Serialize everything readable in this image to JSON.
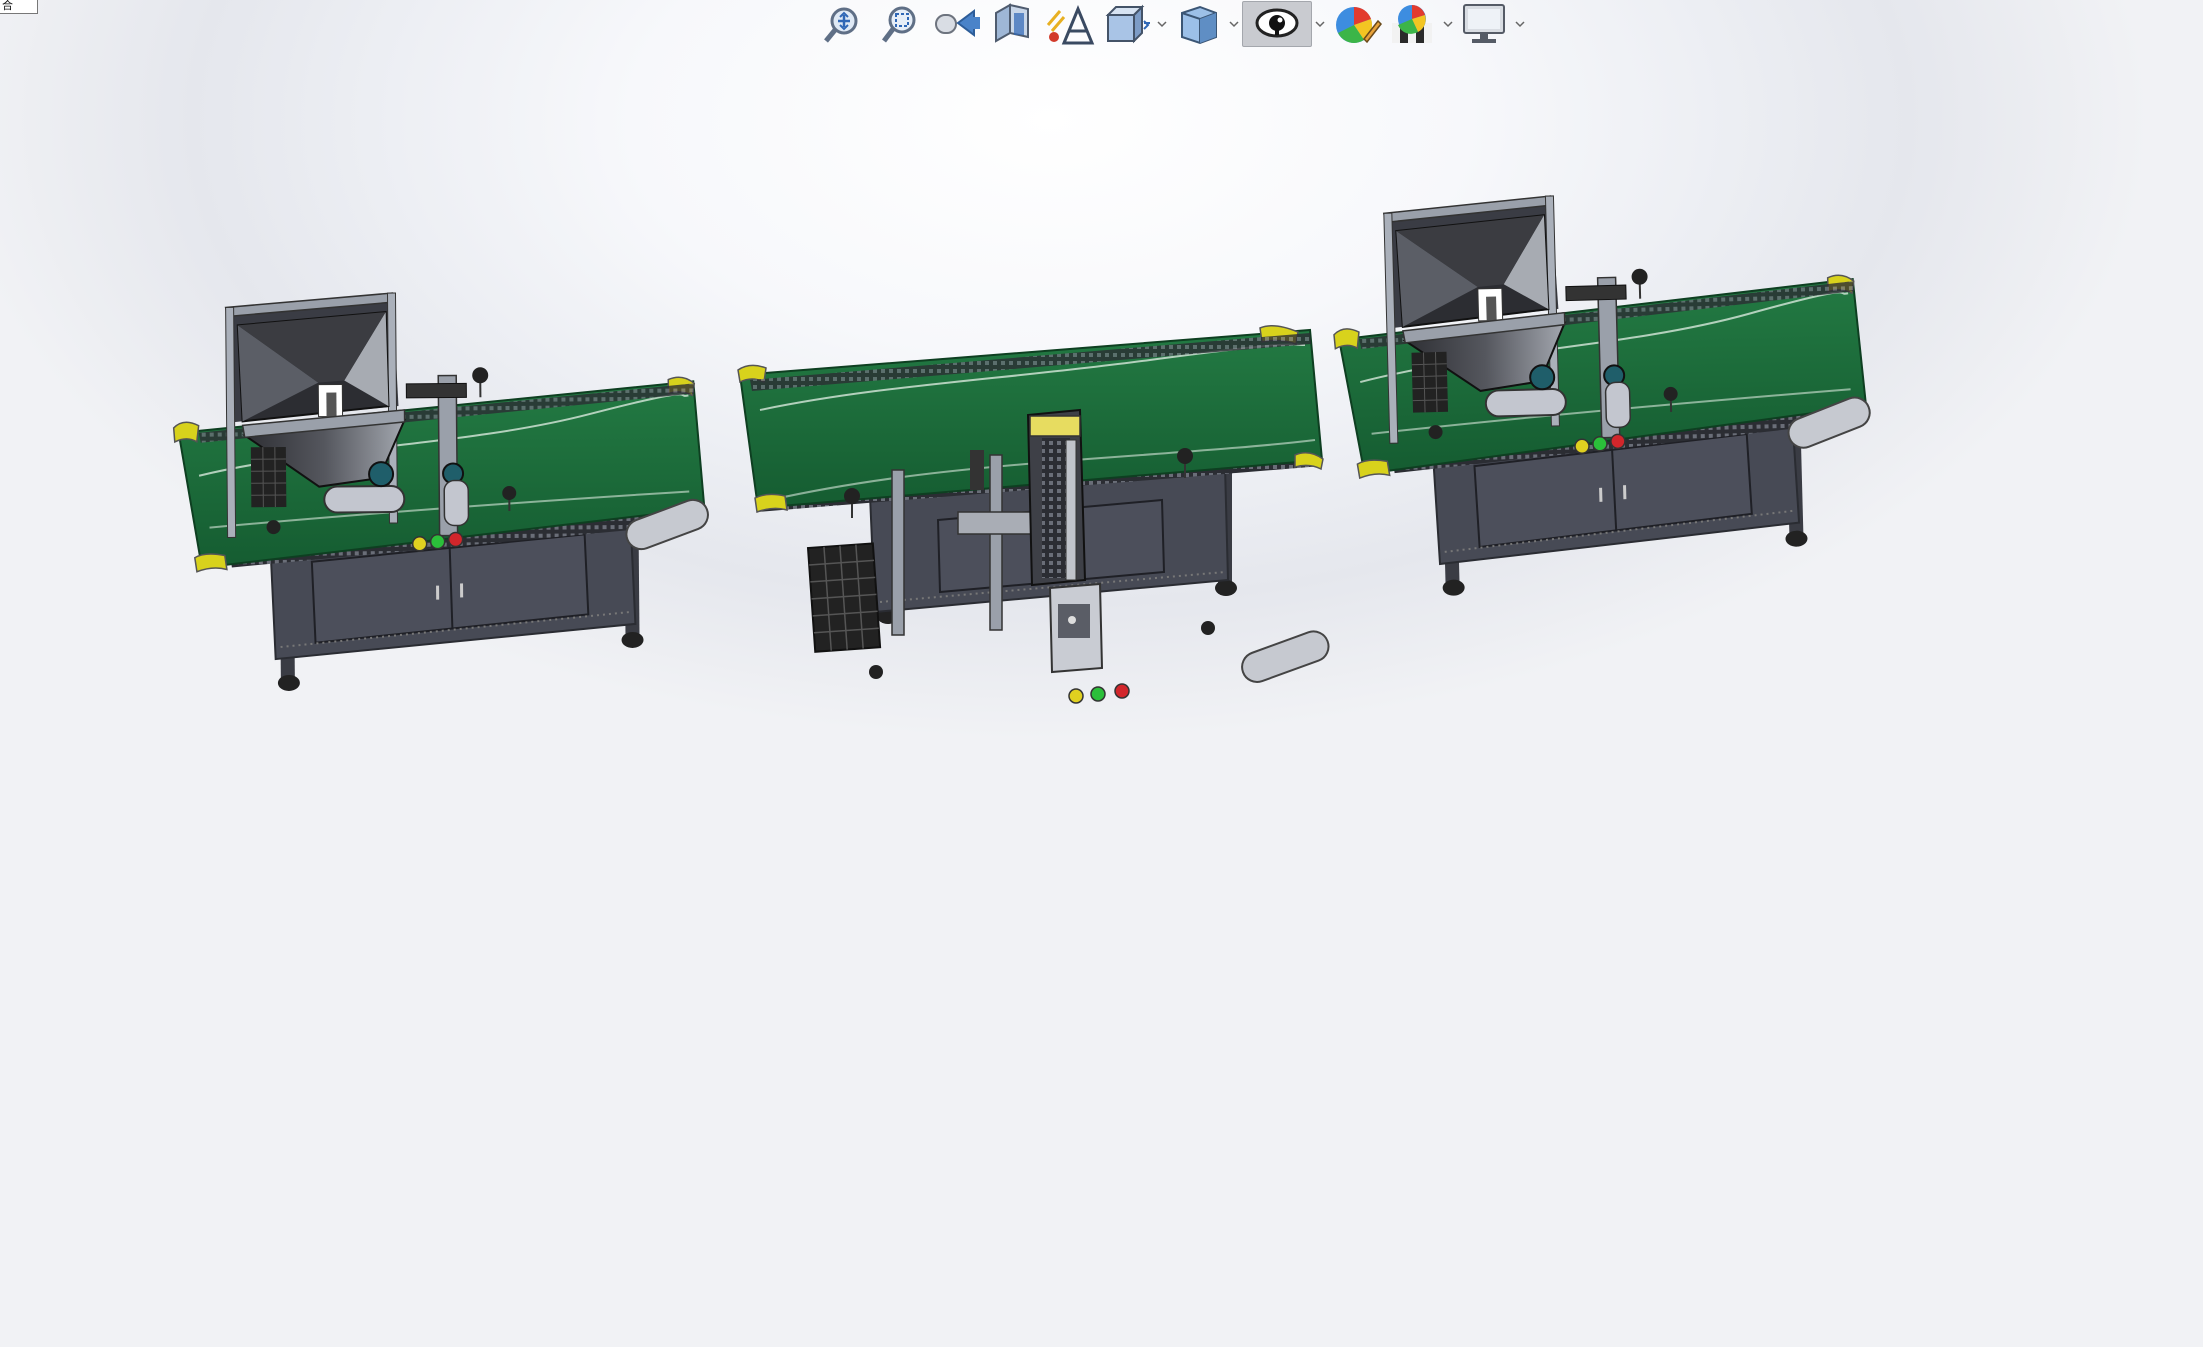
{
  "window": {
    "corner_tab_text": "合"
  },
  "heads_up_toolbar": {
    "tools": [
      {
        "icon": "zoom-to-fit-icon"
      },
      {
        "icon": "zoom-to-area-icon"
      },
      {
        "icon": "previous-view-icon"
      },
      {
        "icon": "section-view-icon"
      },
      {
        "icon": "dynamic-annotation-views-icon"
      },
      {
        "icon": "view-orientation-icon",
        "has_dropdown": true
      },
      {
        "icon": "display-style-icon",
        "has_dropdown": true
      },
      {
        "icon": "hide-show-items-icon",
        "has_dropdown": true,
        "active": true
      },
      {
        "icon": "edit-appearance-icon"
      },
      {
        "icon": "apply-scene-icon",
        "has_dropdown": true
      },
      {
        "icon": "view-settings-icon",
        "has_dropdown": true
      }
    ]
  },
  "model": {
    "stations": [
      {
        "type": "hopper-conveyor-station",
        "buttons": [
          "yellow",
          "green",
          "red"
        ]
      },
      {
        "type": "gantry-pick-station",
        "buttons": [
          "yellow",
          "green",
          "red"
        ]
      },
      {
        "type": "hopper-conveyor-station",
        "buttons": [
          "yellow",
          "green",
          "red"
        ]
      }
    ]
  },
  "colors": {
    "belt": "#1d6b3a",
    "belt_edge": "#2a8a4c",
    "frame": "#3d3f48",
    "cabinet": "#474a55",
    "end_cap": "#d8d21c",
    "hopper_dark": "#3a3b40",
    "hopper_light": "#9fa3ab",
    "button_yellow": "#e0d020",
    "button_green": "#2bbf3a",
    "button_red": "#d2262b"
  }
}
